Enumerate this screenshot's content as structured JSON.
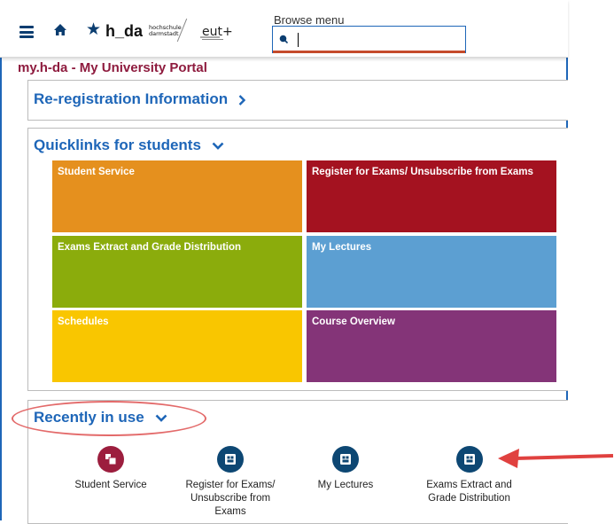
{
  "header": {
    "logo_text": "h_da",
    "logo_sub_line1": "hochschule",
    "logo_sub_line2": "darmstadt",
    "eut_logo_text": "eut+",
    "browse_label": "Browse menu",
    "search_value": "",
    "icons": [
      "hamburger-menu-icon",
      "home-icon",
      "star-icon",
      "search-icon"
    ]
  },
  "portal_title": "my.h-da - My University Portal",
  "reregistration": {
    "title": "Re-registration Information"
  },
  "quicklinks": {
    "title": "Quicklinks for students",
    "tiles": [
      {
        "label": "Student Service",
        "color": "#e5901e"
      },
      {
        "label": "Register for Exams/ Unsubscribe from Exams",
        "color": "#a41220"
      },
      {
        "label": "Exams Extract and Grade Distribution",
        "color": "#8bac0c"
      },
      {
        "label": "My Lectures",
        "color": "#5c9fd2"
      },
      {
        "label": "Schedules",
        "color": "#f9c600"
      },
      {
        "label": "Course Overview",
        "color": "#843478"
      }
    ]
  },
  "recently": {
    "title": "Recently in use",
    "items": [
      {
        "label": "Student Service",
        "color": "#9c1e3e"
      },
      {
        "label": "Register for Exams/ Unsubscribe from Exams",
        "color": "#0d4773"
      },
      {
        "label": "My Lectures",
        "color": "#0d4773"
      },
      {
        "label": "Exams Extract and Grade Distribution",
        "color": "#0d4773"
      }
    ]
  },
  "colors": {
    "accent_blue": "#1e66b8",
    "portal_title": "#8e1b3e",
    "annotation_red": "#e36a6a"
  }
}
